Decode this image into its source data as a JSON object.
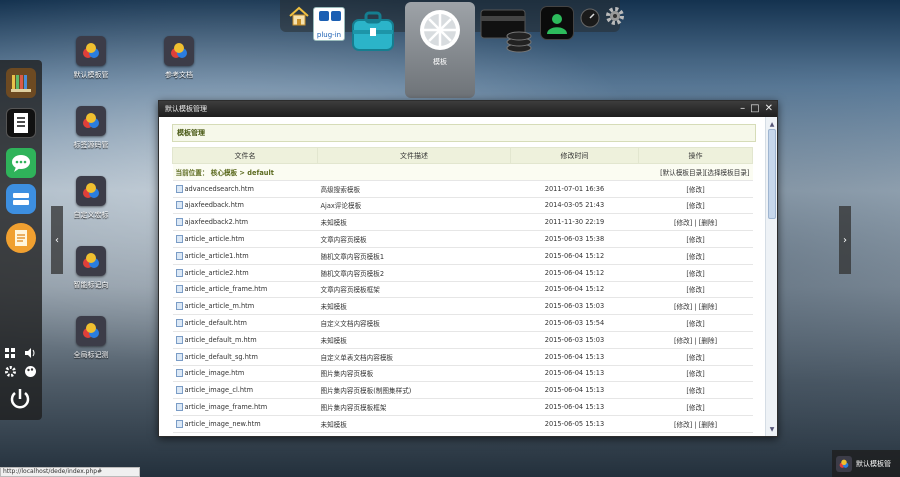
{
  "dock": {
    "plugin_label": "plug-in",
    "templates_label": "模板"
  },
  "desktop_icons": [
    {
      "label": "默认模板管"
    },
    {
      "label": "参考文档"
    },
    {
      "label": "标签源码管"
    },
    {
      "label": "自定义宏标"
    },
    {
      "label": "智能标记向"
    },
    {
      "label": "全局标记测"
    }
  ],
  "window": {
    "title": "默认模板管理",
    "section_title": "模板管理",
    "columns": [
      "文件名",
      "文件描述",
      "修改时间",
      "操作"
    ],
    "location": {
      "prefix": "当前位置：",
      "path": "核心模板 > default",
      "link1": "[默认模板目录]",
      "link2": "[选择模板目录]"
    },
    "rows": [
      {
        "name": "advancedsearch.htm",
        "desc": "高级搜索模板",
        "time": "2011-07-01 16:36",
        "ops": "[修改]"
      },
      {
        "name": "ajaxfeedback.htm",
        "desc": "Ajax评论模板",
        "time": "2014-03-05 21:43",
        "ops": "[修改]"
      },
      {
        "name": "ajaxfeedback2.htm",
        "desc": "未知模板",
        "time": "2011-11-30 22:19",
        "ops": "[修改] | [删除]"
      },
      {
        "name": "article_article.htm",
        "desc": "文章内容页模板",
        "time": "2015-06-03 15:38",
        "ops": "[修改]"
      },
      {
        "name": "article_article1.htm",
        "desc": "随机文章内容页模板1",
        "time": "2015-06-04 15:12",
        "ops": "[修改]"
      },
      {
        "name": "article_article2.htm",
        "desc": "随机文章内容页模板2",
        "time": "2015-06-04 15:12",
        "ops": "[修改]"
      },
      {
        "name": "article_article_frame.htm",
        "desc": "文章内容页模板框架",
        "time": "2015-06-04 15:12",
        "ops": "[修改]"
      },
      {
        "name": "article_article_m.htm",
        "desc": "未知模板",
        "time": "2015-06-03 15:03",
        "ops": "[修改] | [删除]"
      },
      {
        "name": "article_default.htm",
        "desc": "自定义文档内容模板",
        "time": "2015-06-03 15:54",
        "ops": "[修改]"
      },
      {
        "name": "article_default_m.htm",
        "desc": "未知模板",
        "time": "2015-06-03 15:03",
        "ops": "[修改] | [删除]"
      },
      {
        "name": "article_default_sg.htm",
        "desc": "自定义单表文档内容模板",
        "time": "2015-06-04 15:13",
        "ops": "[修改]"
      },
      {
        "name": "article_image.htm",
        "desc": "图片集内容页模板",
        "time": "2015-06-04 15:13",
        "ops": "[修改]"
      },
      {
        "name": "article_image_cl.htm",
        "desc": "图片集内容页模板(制图集样式)",
        "time": "2015-06-04 15:13",
        "ops": "[修改]"
      },
      {
        "name": "article_image_frame.htm",
        "desc": "图片集内容页模板框架",
        "time": "2015-06-04 15:13",
        "ops": "[修改]"
      },
      {
        "name": "article_image_new.htm",
        "desc": "未知模板",
        "time": "2015-06-05 15:13",
        "ops": "[修改] | [删除]"
      }
    ]
  },
  "status_url": "http://localhost/dede/index.php#",
  "taskbar": {
    "label": "默认模板管"
  }
}
